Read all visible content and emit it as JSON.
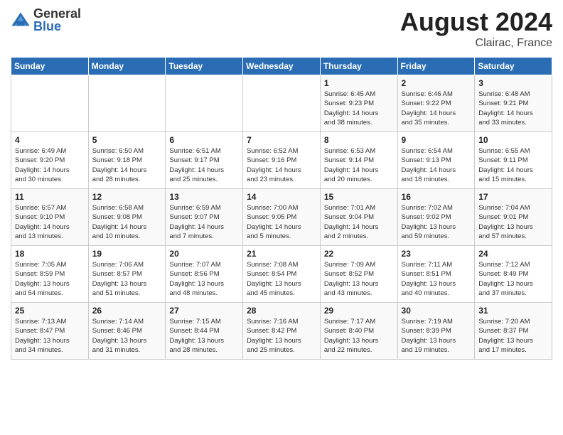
{
  "header": {
    "logo_general": "General",
    "logo_blue": "Blue",
    "title": "August 2024",
    "location": "Clairac, France"
  },
  "days_of_week": [
    "Sunday",
    "Monday",
    "Tuesday",
    "Wednesday",
    "Thursday",
    "Friday",
    "Saturday"
  ],
  "weeks": [
    [
      {
        "day": "",
        "info": ""
      },
      {
        "day": "",
        "info": ""
      },
      {
        "day": "",
        "info": ""
      },
      {
        "day": "",
        "info": ""
      },
      {
        "day": "1",
        "info": "Sunrise: 6:45 AM\nSunset: 9:23 PM\nDaylight: 14 hours\nand 38 minutes."
      },
      {
        "day": "2",
        "info": "Sunrise: 6:46 AM\nSunset: 9:22 PM\nDaylight: 14 hours\nand 35 minutes."
      },
      {
        "day": "3",
        "info": "Sunrise: 6:48 AM\nSunset: 9:21 PM\nDaylight: 14 hours\nand 33 minutes."
      }
    ],
    [
      {
        "day": "4",
        "info": "Sunrise: 6:49 AM\nSunset: 9:20 PM\nDaylight: 14 hours\nand 30 minutes."
      },
      {
        "day": "5",
        "info": "Sunrise: 6:50 AM\nSunset: 9:18 PM\nDaylight: 14 hours\nand 28 minutes."
      },
      {
        "day": "6",
        "info": "Sunrise: 6:51 AM\nSunset: 9:17 PM\nDaylight: 14 hours\nand 25 minutes."
      },
      {
        "day": "7",
        "info": "Sunrise: 6:52 AM\nSunset: 9:16 PM\nDaylight: 14 hours\nand 23 minutes."
      },
      {
        "day": "8",
        "info": "Sunrise: 6:53 AM\nSunset: 9:14 PM\nDaylight: 14 hours\nand 20 minutes."
      },
      {
        "day": "9",
        "info": "Sunrise: 6:54 AM\nSunset: 9:13 PM\nDaylight: 14 hours\nand 18 minutes."
      },
      {
        "day": "10",
        "info": "Sunrise: 6:55 AM\nSunset: 9:11 PM\nDaylight: 14 hours\nand 15 minutes."
      }
    ],
    [
      {
        "day": "11",
        "info": "Sunrise: 6:57 AM\nSunset: 9:10 PM\nDaylight: 14 hours\nand 13 minutes."
      },
      {
        "day": "12",
        "info": "Sunrise: 6:58 AM\nSunset: 9:08 PM\nDaylight: 14 hours\nand 10 minutes."
      },
      {
        "day": "13",
        "info": "Sunrise: 6:59 AM\nSunset: 9:07 PM\nDaylight: 14 hours\nand 7 minutes."
      },
      {
        "day": "14",
        "info": "Sunrise: 7:00 AM\nSunset: 9:05 PM\nDaylight: 14 hours\nand 5 minutes."
      },
      {
        "day": "15",
        "info": "Sunrise: 7:01 AM\nSunset: 9:04 PM\nDaylight: 14 hours\nand 2 minutes."
      },
      {
        "day": "16",
        "info": "Sunrise: 7:02 AM\nSunset: 9:02 PM\nDaylight: 13 hours\nand 59 minutes."
      },
      {
        "day": "17",
        "info": "Sunrise: 7:04 AM\nSunset: 9:01 PM\nDaylight: 13 hours\nand 57 minutes."
      }
    ],
    [
      {
        "day": "18",
        "info": "Sunrise: 7:05 AM\nSunset: 8:59 PM\nDaylight: 13 hours\nand 54 minutes."
      },
      {
        "day": "19",
        "info": "Sunrise: 7:06 AM\nSunset: 8:57 PM\nDaylight: 13 hours\nand 51 minutes."
      },
      {
        "day": "20",
        "info": "Sunrise: 7:07 AM\nSunset: 8:56 PM\nDaylight: 13 hours\nand 48 minutes."
      },
      {
        "day": "21",
        "info": "Sunrise: 7:08 AM\nSunset: 8:54 PM\nDaylight: 13 hours\nand 45 minutes."
      },
      {
        "day": "22",
        "info": "Sunrise: 7:09 AM\nSunset: 8:52 PM\nDaylight: 13 hours\nand 43 minutes."
      },
      {
        "day": "23",
        "info": "Sunrise: 7:11 AM\nSunset: 8:51 PM\nDaylight: 13 hours\nand 40 minutes."
      },
      {
        "day": "24",
        "info": "Sunrise: 7:12 AM\nSunset: 8:49 PM\nDaylight: 13 hours\nand 37 minutes."
      }
    ],
    [
      {
        "day": "25",
        "info": "Sunrise: 7:13 AM\nSunset: 8:47 PM\nDaylight: 13 hours\nand 34 minutes."
      },
      {
        "day": "26",
        "info": "Sunrise: 7:14 AM\nSunset: 8:46 PM\nDaylight: 13 hours\nand 31 minutes."
      },
      {
        "day": "27",
        "info": "Sunrise: 7:15 AM\nSunset: 8:44 PM\nDaylight: 13 hours\nand 28 minutes."
      },
      {
        "day": "28",
        "info": "Sunrise: 7:16 AM\nSunset: 8:42 PM\nDaylight: 13 hours\nand 25 minutes."
      },
      {
        "day": "29",
        "info": "Sunrise: 7:17 AM\nSunset: 8:40 PM\nDaylight: 13 hours\nand 22 minutes."
      },
      {
        "day": "30",
        "info": "Sunrise: 7:19 AM\nSunset: 8:39 PM\nDaylight: 13 hours\nand 19 minutes."
      },
      {
        "day": "31",
        "info": "Sunrise: 7:20 AM\nSunset: 8:37 PM\nDaylight: 13 hours\nand 17 minutes."
      }
    ]
  ]
}
